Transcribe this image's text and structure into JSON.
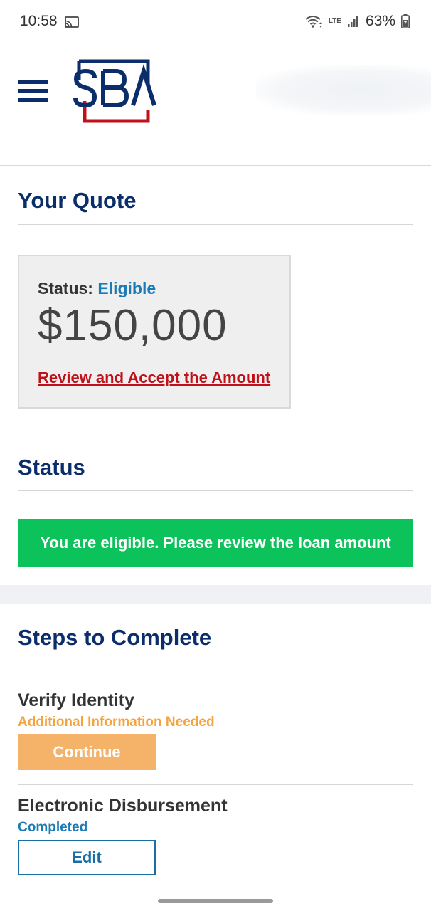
{
  "status_bar": {
    "time": "10:58",
    "network": "LTE",
    "battery": "63%",
    "icons": [
      "cast-icon",
      "wifi-icon",
      "signal-icon",
      "battery-icon"
    ]
  },
  "header": {
    "logo_text": "SBA",
    "menu_icon": "hamburger-menu-icon",
    "brand_colors": {
      "navy": "#0b2e6b",
      "red": "#c0101a"
    }
  },
  "quote": {
    "heading": "Your Quote",
    "status_label": "Status:",
    "status_value": "Eligible",
    "amount": "$150,000",
    "link": "Review and Accept the Amount"
  },
  "status_section": {
    "heading": "Status",
    "banner": "You are eligible. Please review the loan amount",
    "banner_color": "#0cc25a"
  },
  "steps": {
    "heading": "Steps to Complete",
    "items": [
      {
        "title": "Verify Identity",
        "status": "Additional Information Needed",
        "button": "Continue"
      },
      {
        "title": "Electronic Disbursement",
        "status": "Completed",
        "button": "Edit"
      }
    ]
  }
}
